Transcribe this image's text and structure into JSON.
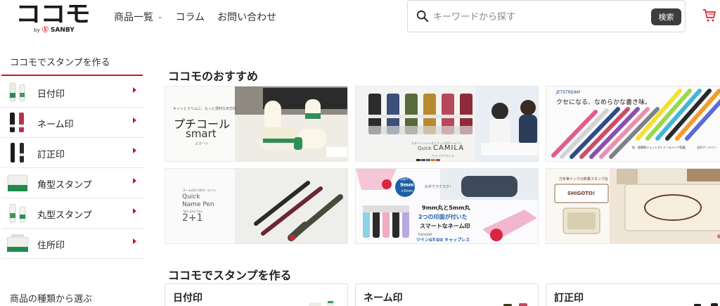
{
  "header": {
    "logo_text": "ココモ",
    "logo_by": "by",
    "logo_brand_mark": "Ⓢ",
    "logo_brand": "SANBY",
    "nav": [
      {
        "label": "商品一覧",
        "has_dropdown": true
      },
      {
        "label": "コラム",
        "has_dropdown": false
      },
      {
        "label": "お問い合わせ",
        "has_dropdown": false
      }
    ],
    "search": {
      "placeholder": "キーワードから探す",
      "value": "",
      "button_label": "検索",
      "icon": "search-icon"
    },
    "cart_icon": "cart-icon",
    "accent_color": "#d7262f"
  },
  "sidebar": {
    "heading": "ココモでスタンプを作る",
    "items": [
      {
        "label": "日付印",
        "thumb": "date-stamp"
      },
      {
        "label": "ネーム印",
        "thumb": "name-stamp"
      },
      {
        "label": "訂正印",
        "thumb": "correction-stamp"
      },
      {
        "label": "角型スタンプ",
        "thumb": "square-stamp"
      },
      {
        "label": "丸型スタンプ",
        "thumb": "round-stamp"
      },
      {
        "label": "住所印",
        "thumb": "address-stamp"
      }
    ],
    "heading2": "商品の種類から選ぶ",
    "accent_color": "#c8161d"
  },
  "main": {
    "recommend_title": "ココモのおすすめ",
    "banners": [
      {
        "id": "petit-coal",
        "tagline": "キャッとスリムに。もっと便利な日付印",
        "title": "プチコール",
        "subtitle": "smart",
        "sub2": "スマート"
      },
      {
        "id": "camila",
        "tagline": "スタイリッシュなリフィル式ネームペン",
        "title": "CAMILA",
        "prefix": "Quick",
        "sub2": "クイッククカミラ"
      },
      {
        "id": "jetstream",
        "brand": "JETSTREAM",
        "title": "クセになる、なめらかな書き味。",
        "note": "油性ボールペン",
        "foot": "低・超摩擦ジェットストリームインク搭載"
      },
      {
        "id": "quick-name-pen",
        "tagline": "ネーム印付 2色ボールペン",
        "title1": "Quick",
        "title2": "Name Pen",
        "sub": "Twin plus One",
        "num": "2+1"
      },
      {
        "id": "capless",
        "bubble1": "印面サイズ",
        "bubble2": "9mm",
        "bubble3": "+5mm",
        "line0": "片手でラクラク！",
        "line1": "9mm丸と5mm丸",
        "line2": "2つの印面が付いた",
        "line3": "スマートなネーム印",
        "brand": "ツインGT-DX キャップレス",
        "maker": "TAKAKIDM"
      },
      {
        "id": "address-ink",
        "title": "万年筆インクの新着スタンプ台",
        "brand": "SHIGOTO!"
      }
    ],
    "make_title": "ココモでスタンプを作る",
    "categories": [
      {
        "label": "日付印"
      },
      {
        "label": "ネーム印"
      },
      {
        "label": "訂正印"
      }
    ]
  }
}
